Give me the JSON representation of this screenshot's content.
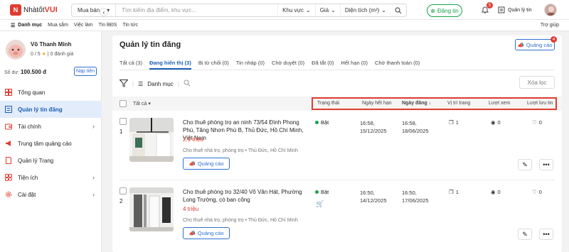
{
  "header": {
    "logo_prefix": "Nhà",
    "logo_mid": "tốt",
    "logo_brand": "VUI",
    "search_category": "Mua bán",
    "search_placeholder": "Tìm kiếm địa điểm, khu vực...",
    "filter_area": "Khu vực",
    "filter_price": "Giá",
    "filter_size": "Diện tích (m²)",
    "post_label": "Đăng tin",
    "notif_count": "5",
    "manage_label": "Quản lý tin"
  },
  "nav": {
    "menu_label": "Danh mục",
    "links": [
      "Mua sắm",
      "Việc làm",
      "Tin BĐS",
      "Tin tức"
    ],
    "help": "Trợ giúp"
  },
  "sidebar": {
    "user_name": "Võ Thanh Minh",
    "rating": "0 / 5",
    "reviews": "0 đánh giá",
    "balance_label": "Số dư:",
    "balance_value": "100.500 đ",
    "topup": "Nạp tiền",
    "items": [
      {
        "label": "Tổng quan"
      },
      {
        "label": "Quản lý tin đăng"
      },
      {
        "label": "Tài chính"
      },
      {
        "label": "Trung tâm quảng cáo"
      },
      {
        "label": "Quản lý Trang"
      },
      {
        "label": "Tiện ích"
      },
      {
        "label": "Cài đặt"
      }
    ]
  },
  "main": {
    "title": "Quản lý tin đăng",
    "ad_button": "Quảng cáo",
    "ad_count": "4",
    "tabs": [
      "Tất cả (3)",
      "Đang hiển thị (3)",
      "Bị từ chối (0)",
      "Tin nháp (0)",
      "Chờ duyệt (0)",
      "Đã tắt (0)",
      "Hết hạn (0)",
      "Chờ thanh toán (0)"
    ],
    "toolbar": {
      "category": "Danh mục",
      "clear": "Xóa lọc"
    },
    "columns": {
      "all": "Tất cả",
      "status": "Trạng thái",
      "expire": "Ngày hết hạn",
      "posted": "Ngày đăng",
      "position": "Vị trí trang",
      "views": "Lượt xem",
      "saves": "Lượt lưu tin"
    },
    "rows": [
      {
        "index": "1",
        "title": "Cho thuê phòng trọ an ninh 73/54 Đình Phong Phú, Tăng Nhơn Phú B, Thủ Đức, Hồ Chí Minh, Việt Nam",
        "price": "2.9 triệu",
        "category": "Cho thuê nhà trọ, phòng trọ",
        "location": "Thủ Đức, Hồ Chí Minh",
        "ad_label": "Quảng cáo",
        "status": "Bật",
        "expire_time": "16:58,",
        "expire_date": "15/12/2025",
        "post_time": "16:58,",
        "post_date": "18/06/2025",
        "position": "1",
        "views": "0",
        "saves": "0"
      },
      {
        "index": "2",
        "title": "Cho thuê phòng trọ 32/40 Võ Văn Hát, Phường Long Trường, có ban công",
        "price": "4 triệu",
        "category": "Cho thuê nhà trọ, phòng trọ",
        "location": "Thủ Đức, Hồ Chí Minh",
        "ad_label": "Quảng cáo",
        "status": "Bật",
        "expire_time": "16:50,",
        "expire_date": "14/12/2025",
        "post_time": "16:50,",
        "post_date": "17/06/2025",
        "position": "1",
        "views": "0",
        "saves": "0"
      }
    ]
  },
  "colors": {
    "brand": "#e03c31",
    "accent": "#1a5fb4",
    "green": "#17a34a"
  }
}
